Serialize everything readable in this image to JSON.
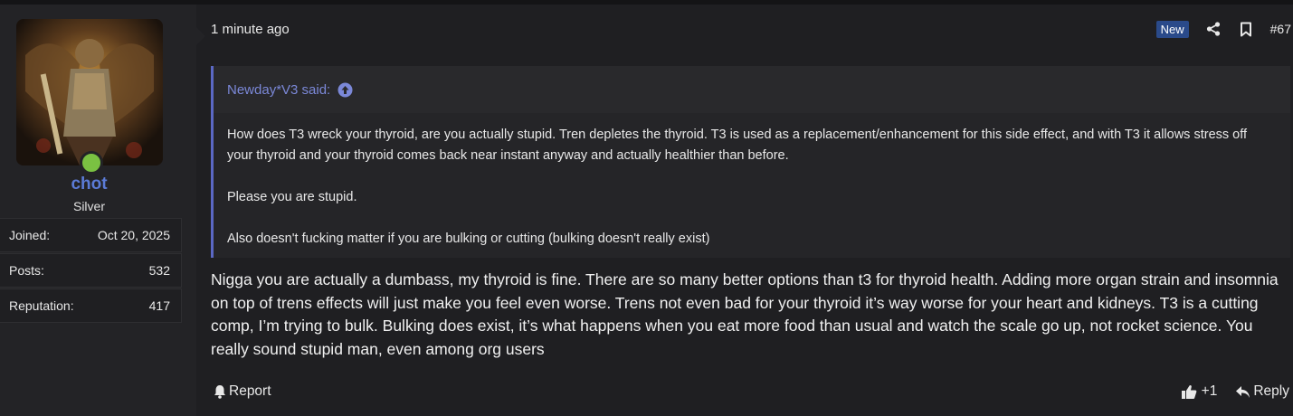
{
  "user": {
    "name": "chot",
    "title": "Silver",
    "online": true,
    "stats": [
      {
        "label": "Joined:",
        "value": "Oct 20, 2025"
      },
      {
        "label": "Posts:",
        "value": "532"
      },
      {
        "label": "Reputation:",
        "value": "417"
      }
    ]
  },
  "post": {
    "timestamp": "1 minute ago",
    "badge": "New",
    "number": "#67",
    "quote": {
      "author_line": "Newday*V3 said:",
      "paragraphs": [
        "How does T3 wreck your thyroid, are you actually stupid. Tren depletes the thyroid. T3 is used as a replacement/enhancement for this side effect, and with T3 it allows stress off your thyroid and your thyroid comes back near instant anyway and actually healthier than before.",
        "Please you are stupid.",
        "Also doesn't fucking matter if you are bulking or cutting (bulking doesn't really exist)"
      ]
    },
    "body": "Nigga you are actually a dumbass, my thyroid is fine. There are so many better options than t3 for thyroid health. Adding more organ strain and insomnia on top of trens effects will just make you feel even worse. Trens not even bad for your thyroid it’s way worse for your heart and kidneys. T3 is a cutting comp, I’m trying to bulk. Bulking does exist, it’s what happens when you eat more food than usual and watch the scale go up, not rocket science. You really sound stupid man, even among org users",
    "actions": {
      "report": "Report",
      "like_count": "+1",
      "reply": "Reply"
    }
  },
  "colors": {
    "username": "#5b7bd6",
    "quote_accent": "#5b68c4",
    "online": "#7ac142",
    "badge_bg": "#2a4a8a"
  },
  "icons": {
    "share": "share-icon",
    "bookmark": "bookmark-icon",
    "quote_jump": "arrow-up-circle-icon",
    "report": "bell-icon",
    "like": "thumbs-up-icon",
    "reply": "reply-icon"
  }
}
